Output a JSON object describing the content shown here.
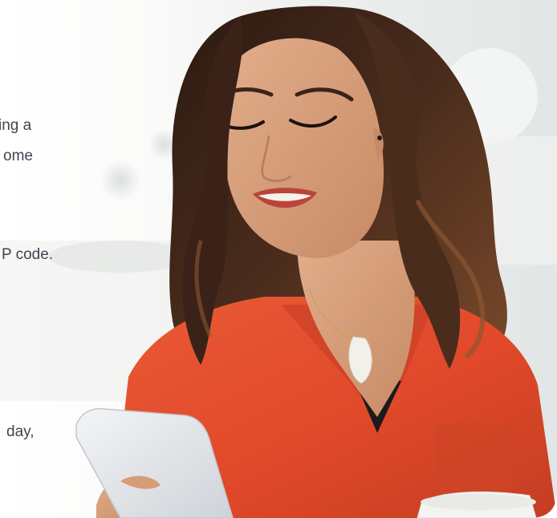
{
  "photo": {
    "subject": "woman-looking-at-phone",
    "colors": {
      "background_light": "#f4f4f2",
      "background_mid": "#e4e6e5",
      "shirt": "#e2502f",
      "shirt_shadow": "#b83a22",
      "hair": "#3b2418",
      "hair_highlight": "#7a4a2c",
      "skin": "#d9a07c",
      "skin_shadow": "#b97b5a",
      "phone": "#e7e9ec",
      "cup": "#f3f3f1"
    }
  },
  "text_fragments": [
    "ing a",
    "ome",
    "P code.",
    "day,"
  ]
}
